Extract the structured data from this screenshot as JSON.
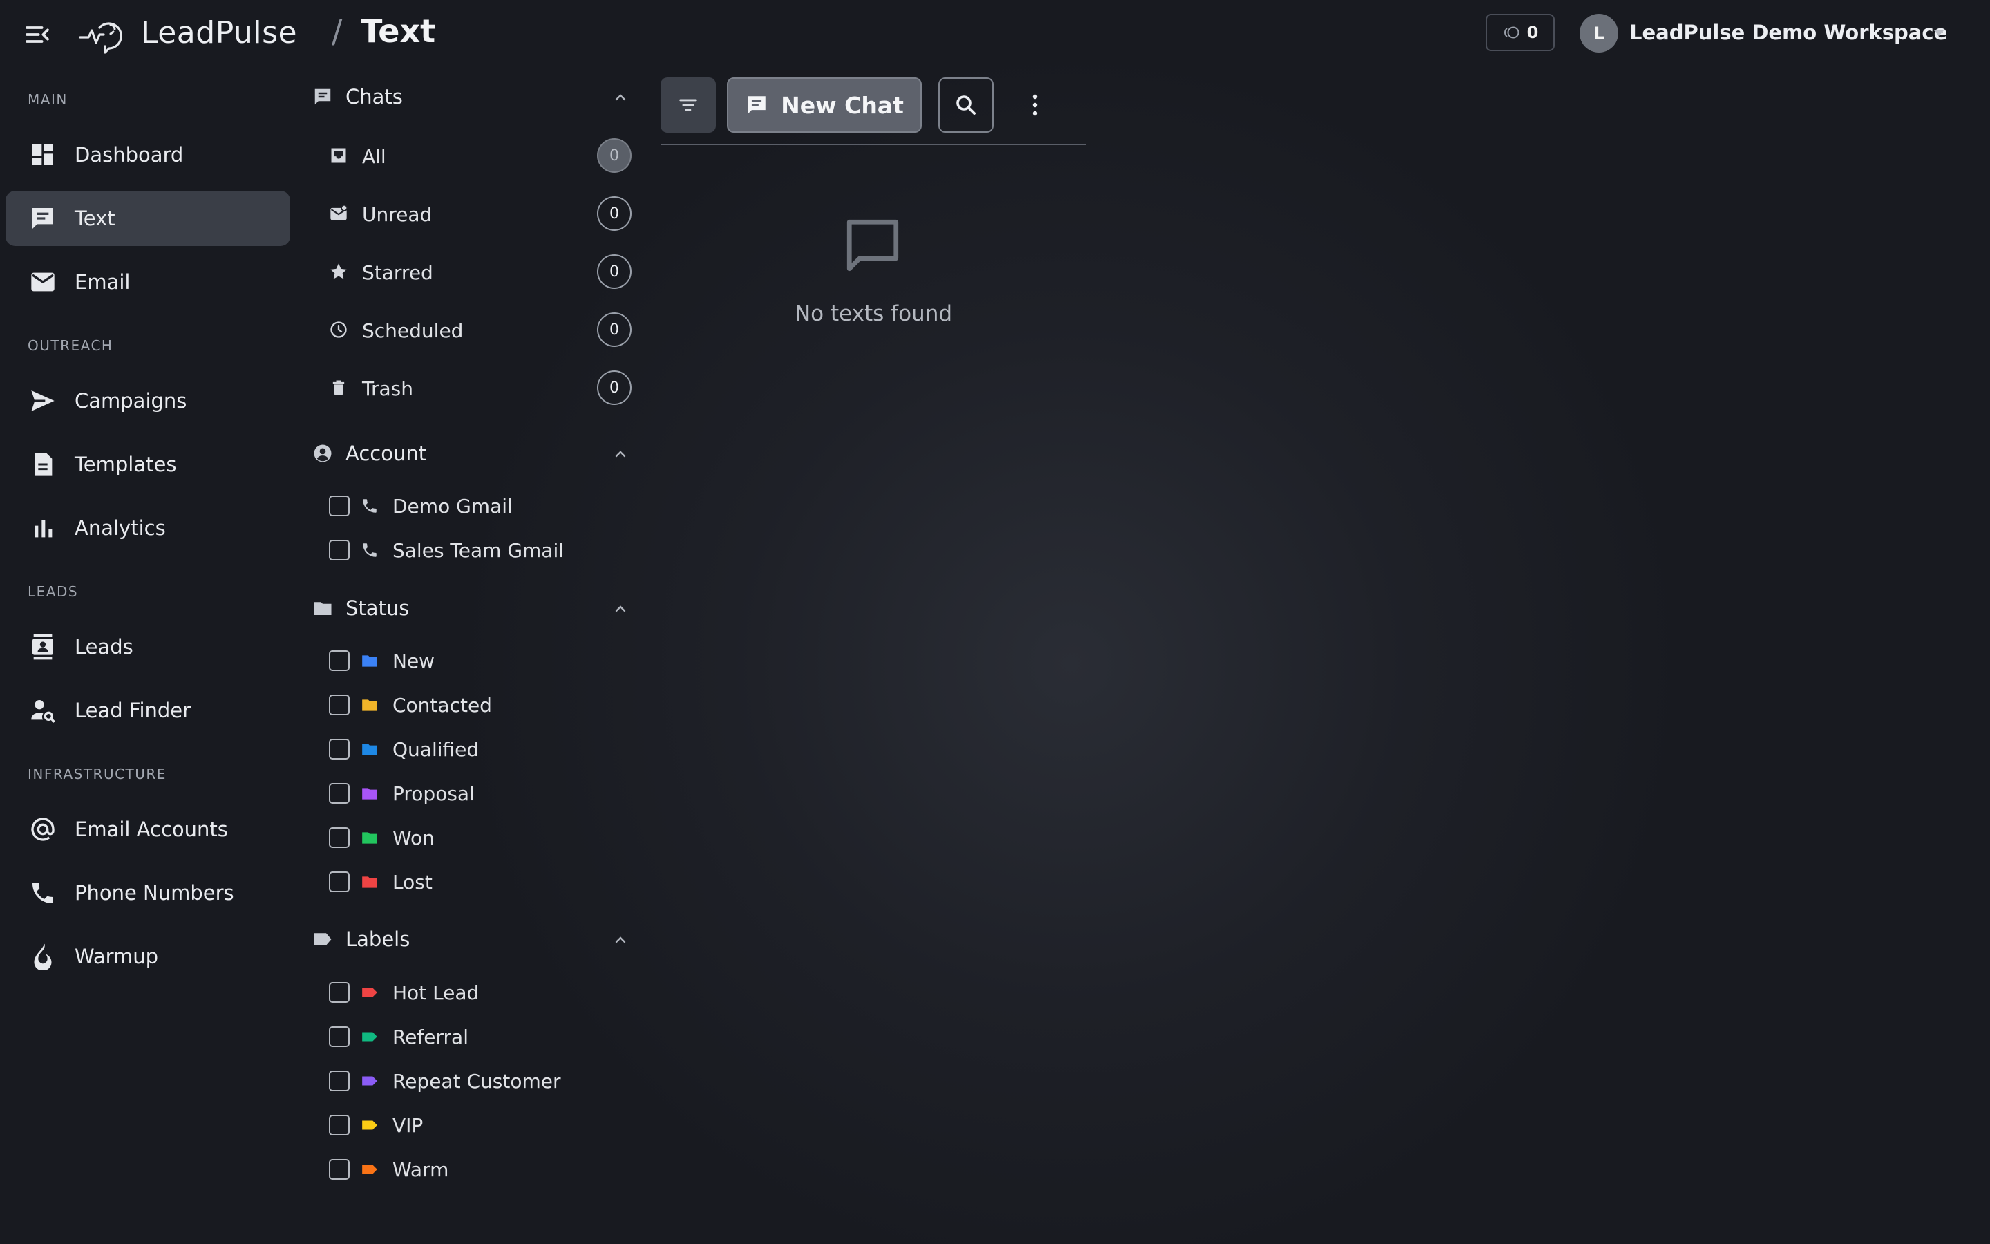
{
  "header": {
    "brand": "LeadPulse",
    "breadcrumb_separator": "/",
    "page_title": "Text",
    "credits": "0",
    "avatar_initial": "L",
    "workspace_name": "LeadPulse Demo Workspace"
  },
  "nav": {
    "sections": {
      "main": "MAIN",
      "outreach": "OUTREACH",
      "leads": "LEADS",
      "infrastructure": "INFRASTRUCTURE"
    },
    "items": {
      "dashboard": "Dashboard",
      "text": "Text",
      "email": "Email",
      "campaigns": "Campaigns",
      "templates": "Templates",
      "analytics": "Analytics",
      "leads": "Leads",
      "lead_finder": "Lead Finder",
      "email_accounts": "Email Accounts",
      "phone_numbers": "Phone Numbers",
      "warmup": "Warmup"
    },
    "active": "text"
  },
  "filters": {
    "chats": {
      "title": "Chats",
      "all": {
        "label": "All",
        "count": "0"
      },
      "unread": {
        "label": "Unread",
        "count": "0"
      },
      "starred": {
        "label": "Starred",
        "count": "0"
      },
      "scheduled": {
        "label": "Scheduled",
        "count": "0"
      },
      "trash": {
        "label": "Trash",
        "count": "0"
      }
    },
    "account": {
      "title": "Account",
      "items": [
        "Demo Gmail",
        "Sales Team Gmail"
      ]
    },
    "status": {
      "title": "Status",
      "items": [
        "New",
        "Contacted",
        "Qualified",
        "Proposal",
        "Won",
        "Lost"
      ],
      "colors": [
        "#3b82f6",
        "#f0b429",
        "#1e88e5",
        "#a855f7",
        "#22c55e",
        "#ef4444"
      ]
    },
    "labels": {
      "title": "Labels",
      "items": [
        "Hot Lead",
        "Referral",
        "Repeat Customer",
        "VIP",
        "Warm"
      ],
      "colors": [
        "#ef4444",
        "#10b981",
        "#8b5cf6",
        "#facc15",
        "#f97316"
      ]
    }
  },
  "toolbar": {
    "new_chat_label": "New Chat"
  },
  "empty_state": {
    "message": "No texts found"
  }
}
